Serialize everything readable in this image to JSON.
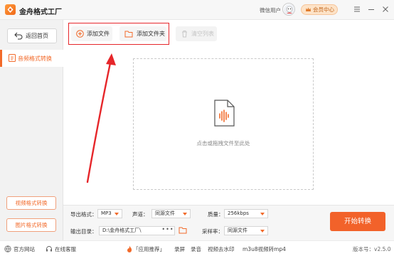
{
  "app": {
    "title": "金舟格式工厂"
  },
  "user": {
    "label": "微信用户",
    "vip": "会员中心"
  },
  "sidebar": {
    "back": "返回首页",
    "active": "音频格式转换",
    "video_convert": "视频格式转换",
    "image_convert": "图片格式转换"
  },
  "toolbar": {
    "add_file": "添加文件",
    "add_folder": "添加文件夹",
    "clear": "清空列表"
  },
  "dropzone": {
    "hint": "点击或拖拽文件至此处"
  },
  "settings": {
    "format_label": "导出格式：",
    "format_value": "MP3",
    "channel_label": "声道：",
    "channel_value": "同源文件",
    "quality_label": "质量：",
    "quality_value": "256kbps",
    "dir_label": "输出目录：",
    "dir_value": "D:\\金舟格式工厂\\",
    "dir_more": "•••",
    "rate_label": "采样率：",
    "rate_value": "同源文件",
    "start": "开始转换"
  },
  "statusbar": {
    "website": "官方网站",
    "service": "在线客服",
    "recommend": "「应用推荐」",
    "rec1": "录屏",
    "rec2": "录音",
    "rec3": "视频去水印",
    "rec4": "m3u8视频转mp4",
    "version": "版本号：v2.5.0"
  },
  "colors": {
    "accent": "#f26a2a",
    "highlight": "#e6262a"
  }
}
